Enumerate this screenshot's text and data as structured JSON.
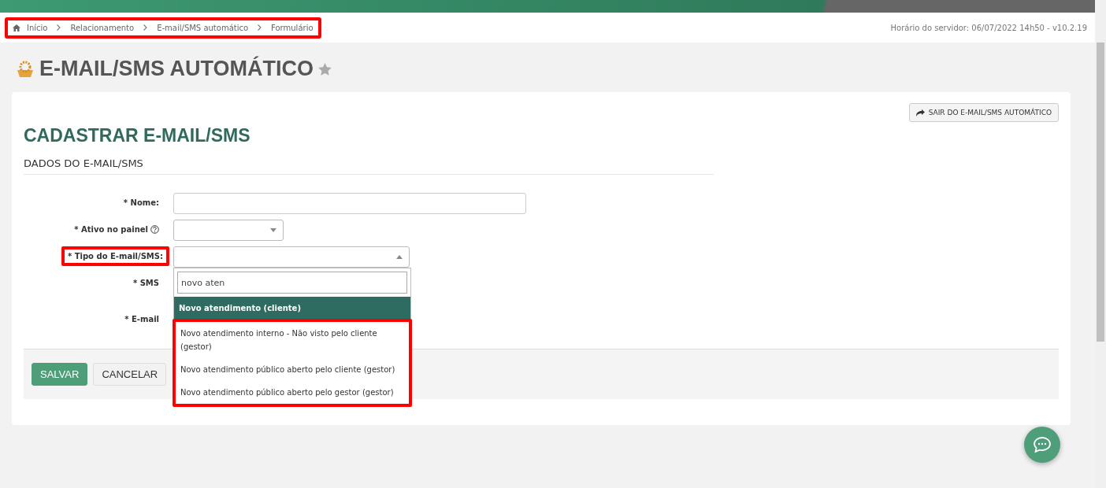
{
  "breadcrumb": {
    "highlighted": true,
    "items": [
      "Início",
      "Relacionamento",
      "E-mail/SMS automático",
      "Formulário"
    ]
  },
  "server_info": "Horário do servidor: 06/07/2022 14h50 - v10.2.19",
  "page_title": "E-MAIL/SMS AUTOMÁTICO",
  "exit_button": "SAIR DO E-MAIL/SMS AUTOMÁTICO",
  "form_title": "CADASTRAR E-MAIL/SMS",
  "section_title": "DADOS DO E-MAIL/SMS",
  "fields": [
    {
      "label": "* Nome:",
      "kind": "text",
      "highlighted": false,
      "help": false
    },
    {
      "label": "* Ativo no painel",
      "kind": "select",
      "highlighted": false,
      "help": true
    },
    {
      "label": "* Tipo do E-mail/SMS:",
      "kind": "select-open",
      "highlighted": true,
      "help": false,
      "dropdown": {
        "search": "novo aten",
        "options": [
          {
            "label": "Novo atendimento (cliente)",
            "selected": true,
            "highlighted": false
          },
          {
            "label": "Novo atendimento interno - Não visto pelo cliente (gestor)",
            "selected": false,
            "highlighted": true
          },
          {
            "label": "Novo atendimento público aberto pelo cliente (gestor)",
            "selected": false,
            "highlighted": true
          },
          {
            "label": "Novo atendimento público aberto pelo gestor (gestor)",
            "selected": false,
            "highlighted": true
          }
        ]
      }
    },
    {
      "label": "* SMS",
      "kind": "covered",
      "highlighted": false,
      "help": false
    },
    {
      "label": "* E-mail",
      "kind": "covered",
      "highlighted": false,
      "help": false
    }
  ],
  "actions": [
    {
      "label": "SALVAR",
      "kind": "primary"
    },
    {
      "label": "CANCELAR",
      "kind": "secondary"
    }
  ]
}
